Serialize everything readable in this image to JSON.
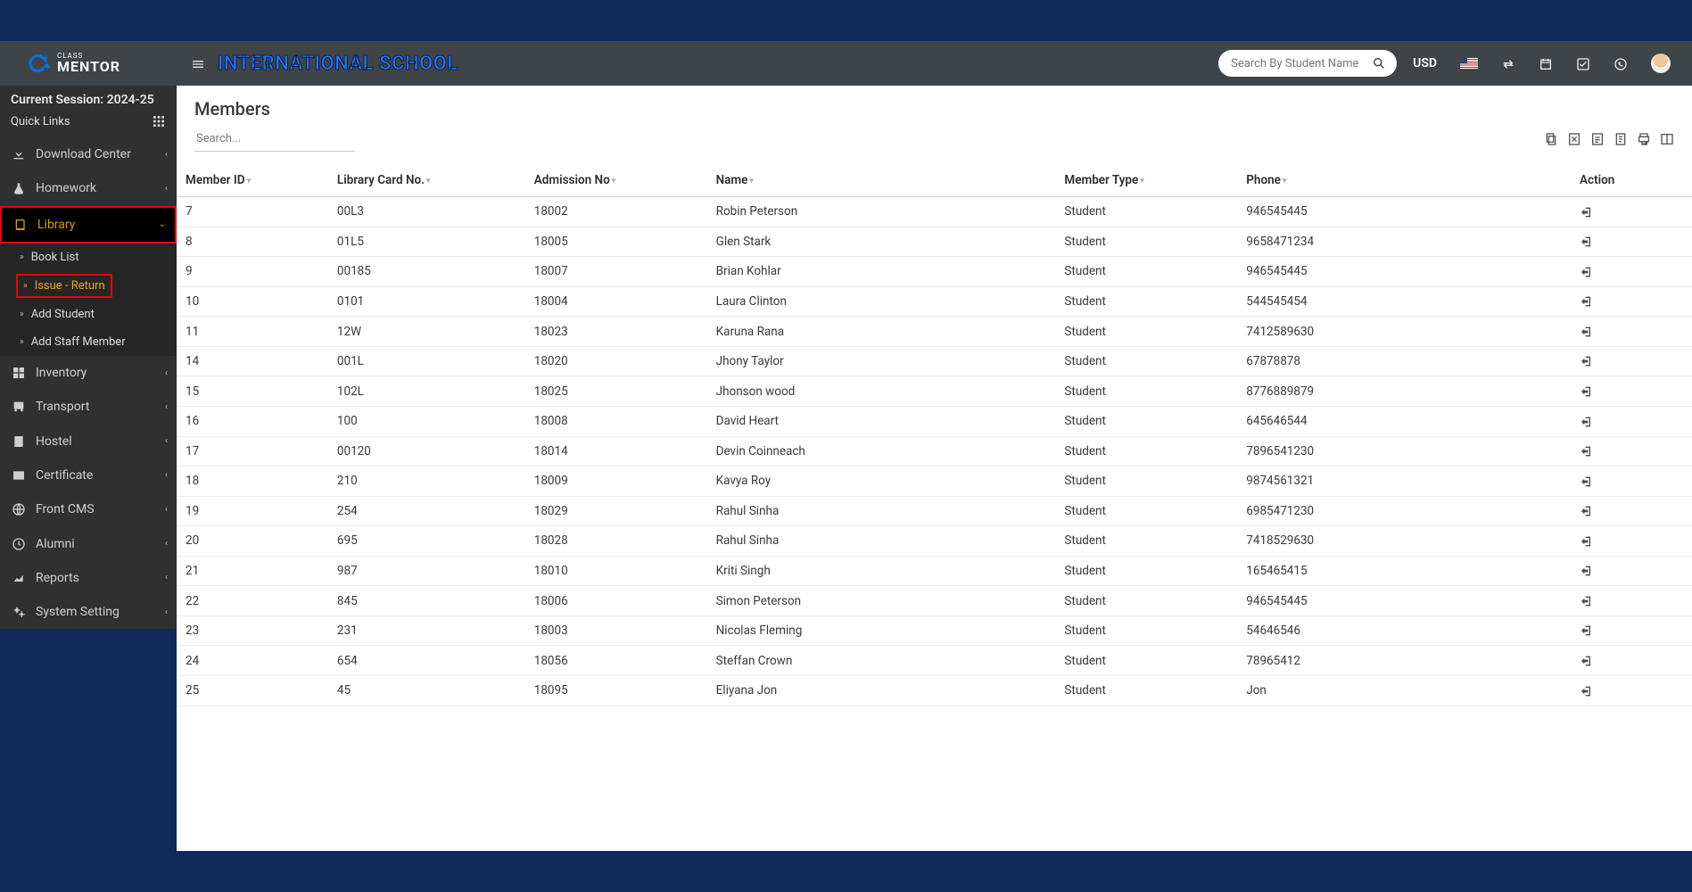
{
  "brand": {
    "cm": "CM",
    "line1": "CLASS",
    "line2": "MENTOR"
  },
  "header": {
    "school_title": "INTERNATIONAL SCHOOL",
    "search_placeholder": "Search By Student Name",
    "currency": "USD"
  },
  "sidebar": {
    "session": "Current Session: 2024-25",
    "quick_links": "Quick Links",
    "items": [
      {
        "icon": "download",
        "label": "Download Center"
      },
      {
        "icon": "flask",
        "label": "Homework"
      },
      {
        "icon": "book",
        "label": "Library",
        "active": true
      },
      {
        "icon": "boxes",
        "label": "Inventory"
      },
      {
        "icon": "bus",
        "label": "Transport"
      },
      {
        "icon": "building",
        "label": "Hostel"
      },
      {
        "icon": "idcard",
        "label": "Certificate"
      },
      {
        "icon": "globe",
        "label": "Front CMS"
      },
      {
        "icon": "clock",
        "label": "Alumni"
      },
      {
        "icon": "chart",
        "label": "Reports"
      },
      {
        "icon": "cogs",
        "label": "System Setting"
      }
    ],
    "library_sub": [
      {
        "label": "Book List"
      },
      {
        "label": "Issue - Return",
        "selected": true
      },
      {
        "label": "Add Student"
      },
      {
        "label": "Add Staff Member"
      }
    ]
  },
  "page": {
    "title": "Members",
    "search_placeholder": "Search...",
    "columns": {
      "member_id": "Member ID",
      "card_no": "Library Card No.",
      "admission_no": "Admission No",
      "name": "Name",
      "member_type": "Member Type",
      "phone": "Phone",
      "action": "Action"
    },
    "rows": [
      {
        "id": "7",
        "card": "00L3",
        "adm": "18002",
        "name": "Robin Peterson",
        "type": "Student",
        "phone": "946545445"
      },
      {
        "id": "8",
        "card": "01L5",
        "adm": "18005",
        "name": "Glen Stark",
        "type": "Student",
        "phone": "9658471234"
      },
      {
        "id": "9",
        "card": "00185",
        "adm": "18007",
        "name": "Brian Kohlar",
        "type": "Student",
        "phone": "946545445"
      },
      {
        "id": "10",
        "card": "0101",
        "adm": "18004",
        "name": "Laura Clinton",
        "type": "Student",
        "phone": "544545454"
      },
      {
        "id": "11",
        "card": "12W",
        "adm": "18023",
        "name": "Karuna Rana",
        "type": "Student",
        "phone": "7412589630"
      },
      {
        "id": "14",
        "card": "001L",
        "adm": "18020",
        "name": "Jhony Taylor",
        "type": "Student",
        "phone": "67878878"
      },
      {
        "id": "15",
        "card": "102L",
        "adm": "18025",
        "name": "Jhonson wood",
        "type": "Student",
        "phone": "8776889879"
      },
      {
        "id": "16",
        "card": "100",
        "adm": "18008",
        "name": "David Heart",
        "type": "Student",
        "phone": "645646544"
      },
      {
        "id": "17",
        "card": "00120",
        "adm": "18014",
        "name": "Devin Coinneach",
        "type": "Student",
        "phone": "7896541230"
      },
      {
        "id": "18",
        "card": "210",
        "adm": "18009",
        "name": "Kavya Roy",
        "type": "Student",
        "phone": "9874561321"
      },
      {
        "id": "19",
        "card": "254",
        "adm": "18029",
        "name": "Rahul Sinha",
        "type": "Student",
        "phone": "6985471230"
      },
      {
        "id": "20",
        "card": "695",
        "adm": "18028",
        "name": "Rahul Sinha",
        "type": "Student",
        "phone": "7418529630"
      },
      {
        "id": "21",
        "card": "987",
        "adm": "18010",
        "name": "Kriti Singh",
        "type": "Student",
        "phone": "165465415"
      },
      {
        "id": "22",
        "card": "845",
        "adm": "18006",
        "name": "Simon Peterson",
        "type": "Student",
        "phone": "946545445"
      },
      {
        "id": "23",
        "card": "231",
        "adm": "18003",
        "name": "Nicolas Fleming",
        "type": "Student",
        "phone": "54646546"
      },
      {
        "id": "24",
        "card": "654",
        "adm": "18056",
        "name": "Steffan Crown",
        "type": "Student",
        "phone": "78965412"
      },
      {
        "id": "25",
        "card": "45",
        "adm": "18095",
        "name": "Eliyana Jon",
        "type": "Student",
        "phone": "Jon"
      }
    ]
  }
}
